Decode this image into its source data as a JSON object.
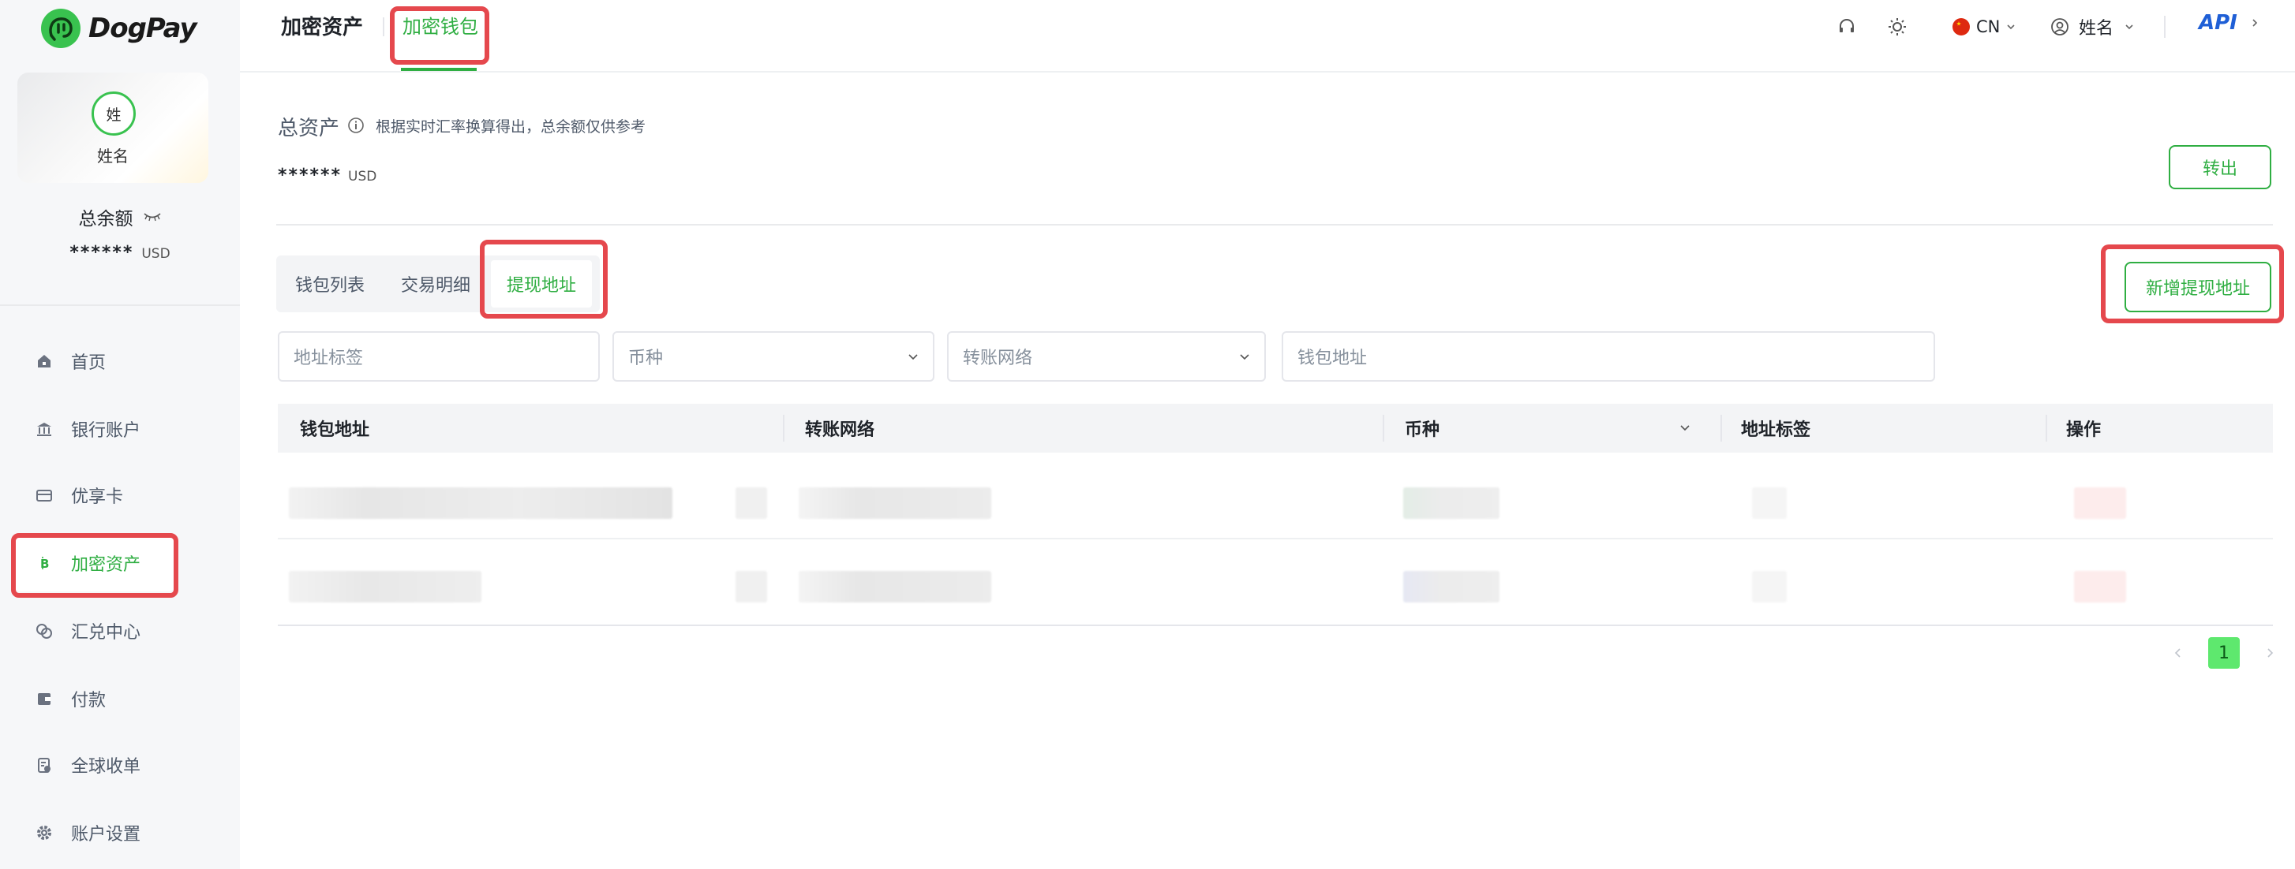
{
  "brand": {
    "name": "DogPay"
  },
  "profile": {
    "avatar_text": "姓",
    "name": "姓名"
  },
  "balance": {
    "label": "总余额",
    "value": "******",
    "currency": "USD"
  },
  "sidebar": {
    "items": [
      {
        "label": "首页",
        "icon": "home-icon",
        "active": false
      },
      {
        "label": "银行账户",
        "icon": "bank-icon",
        "active": false
      },
      {
        "label": "优享卡",
        "icon": "card-icon",
        "active": false
      },
      {
        "label": "加密资产",
        "icon": "bitcoin-icon",
        "active": true
      },
      {
        "label": "汇兑中心",
        "icon": "exchange-icon",
        "active": false
      },
      {
        "label": "付款",
        "icon": "wallet-icon",
        "active": false
      },
      {
        "label": "全球收单",
        "icon": "receipt-icon",
        "active": false
      },
      {
        "label": "账户设置",
        "icon": "gear-icon",
        "active": false
      }
    ]
  },
  "header": {
    "nav_main": "加密资产",
    "nav_wallet": "加密钱包",
    "lang": "CN",
    "user": "姓名",
    "api": "API"
  },
  "summary": {
    "total_label": "总资产",
    "hint": "根据实时汇率换算得出，总余额仅供参考",
    "value": "******",
    "currency": "USD",
    "transfer_label": "转出"
  },
  "tabs": [
    {
      "label": "钱包列表",
      "active": false
    },
    {
      "label": "交易明细",
      "active": false
    },
    {
      "label": "提现地址",
      "active": true
    }
  ],
  "add_button": "新增提现地址",
  "filters": {
    "label_placeholder": "地址标签",
    "coin_placeholder": "币种",
    "network_placeholder": "转账网络",
    "address_placeholder": "钱包地址"
  },
  "table": {
    "columns": [
      "钱包地址",
      "转账网络",
      "币种",
      "地址标签",
      "操作"
    ]
  },
  "pagination": {
    "current": "1"
  },
  "colors": {
    "accent": "#2fae42",
    "highlight": "#e5484d",
    "page_active": "#5ee86e"
  }
}
